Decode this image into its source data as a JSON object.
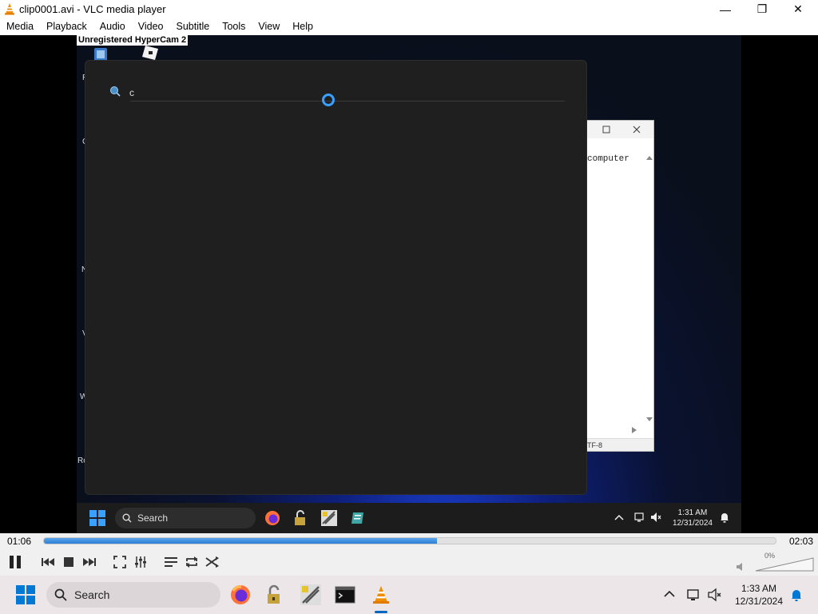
{
  "window": {
    "title": "clip0001.avi - VLC media player",
    "minimize_label": "—",
    "maximize_label": "❐",
    "close_label": "✕"
  },
  "menu": [
    "Media",
    "Playback",
    "Audio",
    "Video",
    "Subtitle",
    "Tools",
    "View",
    "Help"
  ],
  "video": {
    "watermark": "Unregistered HyperCam 2",
    "desktop_icon_letters": [
      "R",
      "C",
      "N",
      "V",
      "W",
      "Ro"
    ],
    "notepad": {
      "text": "computer",
      "status": "TF-8"
    },
    "search_panel": {
      "query": "c"
    },
    "inner_taskbar": {
      "search_label": "Search",
      "time": "1:31 AM",
      "date": "12/31/2024"
    }
  },
  "player": {
    "elapsed": "01:06",
    "duration": "02:03",
    "progress_fraction": 0.537,
    "volume_label": "0%"
  },
  "taskbar": {
    "search_label": "Search",
    "time": "1:33 AM",
    "date": "12/31/2024"
  },
  "colors": {
    "vlc_orange": "#f08c00",
    "progress_blue": "#2f7fd6",
    "windows_blue": "#0067c0"
  }
}
